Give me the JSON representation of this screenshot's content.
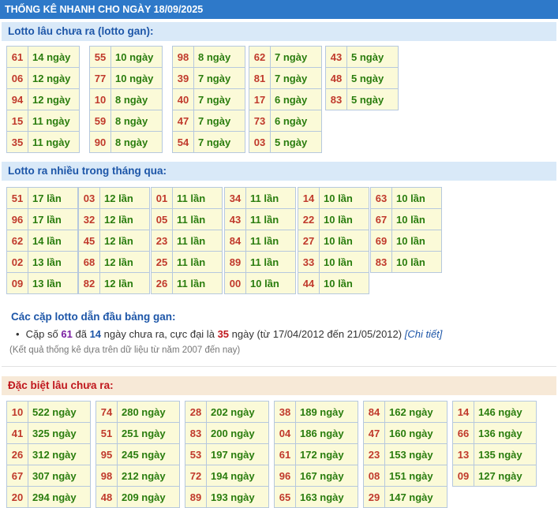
{
  "header": {
    "title": "THỐNG KÊ NHANH CHO NGÀY 18/09/2025"
  },
  "gan": {
    "title": "Lotto lâu chưa ra (lotto gan):",
    "groups": [
      [
        [
          "61",
          "14 ngày"
        ],
        [
          "06",
          "12 ngày"
        ],
        [
          "94",
          "12 ngày"
        ],
        [
          "15",
          "11 ngày"
        ],
        [
          "35",
          "11 ngày"
        ]
      ],
      [
        [
          "55",
          "10 ngày"
        ],
        [
          "77",
          "10 ngày"
        ],
        [
          "10",
          "8 ngày"
        ],
        [
          "59",
          "8 ngày"
        ],
        [
          "90",
          "8 ngày"
        ]
      ],
      [
        [
          "98",
          "8 ngày"
        ],
        [
          "39",
          "7 ngày"
        ],
        [
          "40",
          "7 ngày"
        ],
        [
          "47",
          "7 ngày"
        ],
        [
          "54",
          "7 ngày"
        ]
      ],
      [
        [
          "62",
          "7 ngày"
        ],
        [
          "81",
          "7 ngày"
        ],
        [
          "17",
          "6 ngày"
        ],
        [
          "73",
          "6 ngày"
        ],
        [
          "03",
          "5 ngày"
        ]
      ],
      [
        [
          "43",
          "5 ngày"
        ],
        [
          "48",
          "5 ngày"
        ],
        [
          "83",
          "5 ngày"
        ]
      ]
    ]
  },
  "frequent": {
    "title": "Lotto ra nhiều trong tháng qua:",
    "groups": [
      [
        [
          "51",
          "17 lần"
        ],
        [
          "96",
          "17 lần"
        ],
        [
          "62",
          "14 lần"
        ],
        [
          "02",
          "13 lần"
        ],
        [
          "09",
          "13 lần"
        ]
      ],
      [
        [
          "03",
          "12 lần"
        ],
        [
          "32",
          "12 lần"
        ],
        [
          "45",
          "12 lần"
        ],
        [
          "68",
          "12 lần"
        ],
        [
          "82",
          "12 lần"
        ]
      ],
      [
        [
          "01",
          "11 lần"
        ],
        [
          "05",
          "11 lần"
        ],
        [
          "23",
          "11 lần"
        ],
        [
          "25",
          "11 lần"
        ],
        [
          "26",
          "11 lần"
        ]
      ],
      [
        [
          "34",
          "11 lần"
        ],
        [
          "43",
          "11 lần"
        ],
        [
          "84",
          "11 lần"
        ],
        [
          "89",
          "11 lần"
        ],
        [
          "00",
          "10 lần"
        ]
      ],
      [
        [
          "14",
          "10 lần"
        ],
        [
          "22",
          "10 lần"
        ],
        [
          "27",
          "10 lần"
        ],
        [
          "33",
          "10 lần"
        ],
        [
          "44",
          "10 lần"
        ]
      ],
      [
        [
          "63",
          "10 lần"
        ],
        [
          "67",
          "10 lần"
        ],
        [
          "69",
          "10 lần"
        ],
        [
          "83",
          "10 lần"
        ]
      ]
    ]
  },
  "leading": {
    "title": "Các cặp lotto dẫn đầu bảng gan:",
    "item": {
      "prefix": "Cặp số",
      "pair": "61",
      "mid1": "đã",
      "days": "14",
      "mid2": "ngày chưa ra, cực đại là",
      "max": "35",
      "suffix": "ngày (từ 17/04/2012 đến 21/05/2012)",
      "link": "[Chi tiết]"
    },
    "note": "(Kết quả thống kê dựa trên dữ liệu từ năm 2007 đến nay)"
  },
  "special": {
    "title": "Đặc biệt lâu chưa ra:",
    "groups": [
      [
        [
          "10",
          "522 ngày"
        ],
        [
          "41",
          "325 ngày"
        ],
        [
          "26",
          "312 ngày"
        ],
        [
          "67",
          "307 ngày"
        ],
        [
          "20",
          "294 ngày"
        ]
      ],
      [
        [
          "74",
          "280 ngày"
        ],
        [
          "51",
          "251 ngày"
        ],
        [
          "95",
          "245 ngày"
        ],
        [
          "98",
          "212 ngày"
        ],
        [
          "48",
          "209 ngày"
        ]
      ],
      [
        [
          "28",
          "202 ngày"
        ],
        [
          "83",
          "200 ngày"
        ],
        [
          "53",
          "197 ngày"
        ],
        [
          "72",
          "194 ngày"
        ],
        [
          "89",
          "193 ngày"
        ]
      ],
      [
        [
          "38",
          "189 ngày"
        ],
        [
          "04",
          "186 ngày"
        ],
        [
          "61",
          "172 ngày"
        ],
        [
          "96",
          "167 ngày"
        ],
        [
          "65",
          "163 ngày"
        ]
      ],
      [
        [
          "84",
          "162 ngày"
        ],
        [
          "47",
          "160 ngày"
        ],
        [
          "23",
          "153 ngày"
        ],
        [
          "08",
          "151 ngày"
        ],
        [
          "29",
          "147 ngày"
        ]
      ],
      [
        [
          "14",
          "146 ngày"
        ],
        [
          "66",
          "136 ngày"
        ],
        [
          "13",
          "135 ngày"
        ],
        [
          "09",
          "127 ngày"
        ]
      ]
    ]
  }
}
